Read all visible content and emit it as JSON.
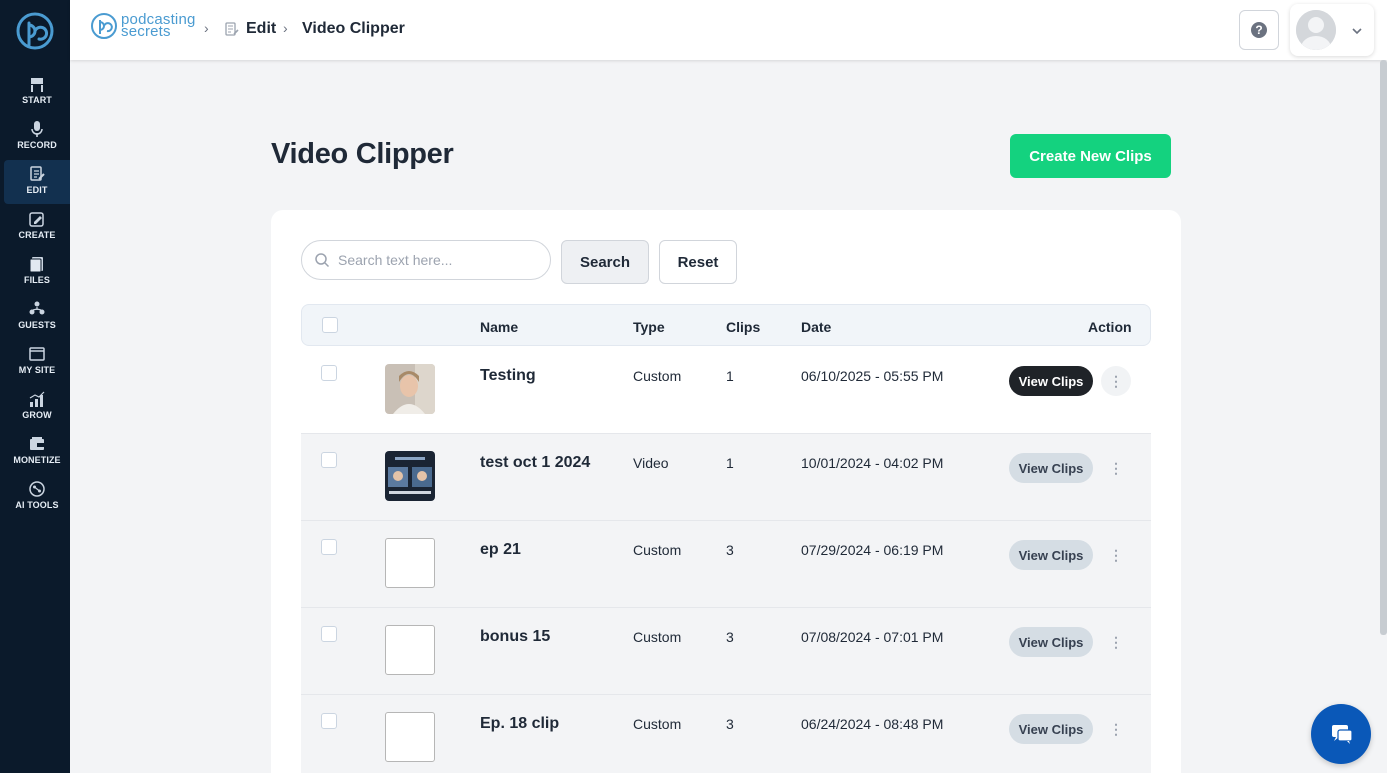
{
  "sidebar": {
    "items": [
      {
        "label": "START",
        "icon": "start-icon"
      },
      {
        "label": "RECORD",
        "icon": "microphone-icon"
      },
      {
        "label": "EDIT",
        "icon": "edit-icon",
        "active": true
      },
      {
        "label": "CREATE",
        "icon": "create-icon"
      },
      {
        "label": "FILES",
        "icon": "files-icon"
      },
      {
        "label": "GUESTS",
        "icon": "guests-icon"
      },
      {
        "label": "MY SITE",
        "icon": "site-icon"
      },
      {
        "label": "GROW",
        "icon": "grow-icon"
      },
      {
        "label": "MONETIZE",
        "icon": "monetize-icon"
      },
      {
        "label": "AI TOOLS",
        "icon": "ai-tools-icon"
      }
    ]
  },
  "header": {
    "brand_line1": "podcasting",
    "brand_line2": "secrets",
    "breadcrumb": [
      "Edit",
      "Video Clipper"
    ]
  },
  "main": {
    "title": "Video Clipper",
    "create_button": "Create New Clips",
    "search_placeholder": "Search text here...",
    "search_button": "Search",
    "reset_button": "Reset"
  },
  "table": {
    "headers": {
      "name": "Name",
      "type": "Type",
      "clips": "Clips",
      "date": "Date",
      "action": "Action"
    },
    "rows": [
      {
        "name": "Testing",
        "type": "Custom",
        "clips": "1",
        "date": "06/10/2025 - 05:55 PM",
        "action": "View Clips"
      },
      {
        "name": "test oct 1 2024",
        "type": "Video",
        "clips": "1",
        "date": "10/01/2024 - 04:02 PM",
        "action": "View Clips"
      },
      {
        "name": "ep 21",
        "type": "Custom",
        "clips": "3",
        "date": "07/29/2024 - 06:19 PM",
        "action": "View Clips"
      },
      {
        "name": "bonus 15",
        "type": "Custom",
        "clips": "3",
        "date": "07/08/2024 - 07:01 PM",
        "action": "View Clips"
      },
      {
        "name": "Ep. 18 clip",
        "type": "Custom",
        "clips": "3",
        "date": "06/24/2024 - 08:48 PM",
        "action": "View Clips"
      }
    ]
  },
  "colors": {
    "sidebar": "#0b1a2b",
    "accent_green": "#14d27f",
    "brand_blue": "#4a9bd1",
    "chat_blue": "#0a58b8"
  }
}
